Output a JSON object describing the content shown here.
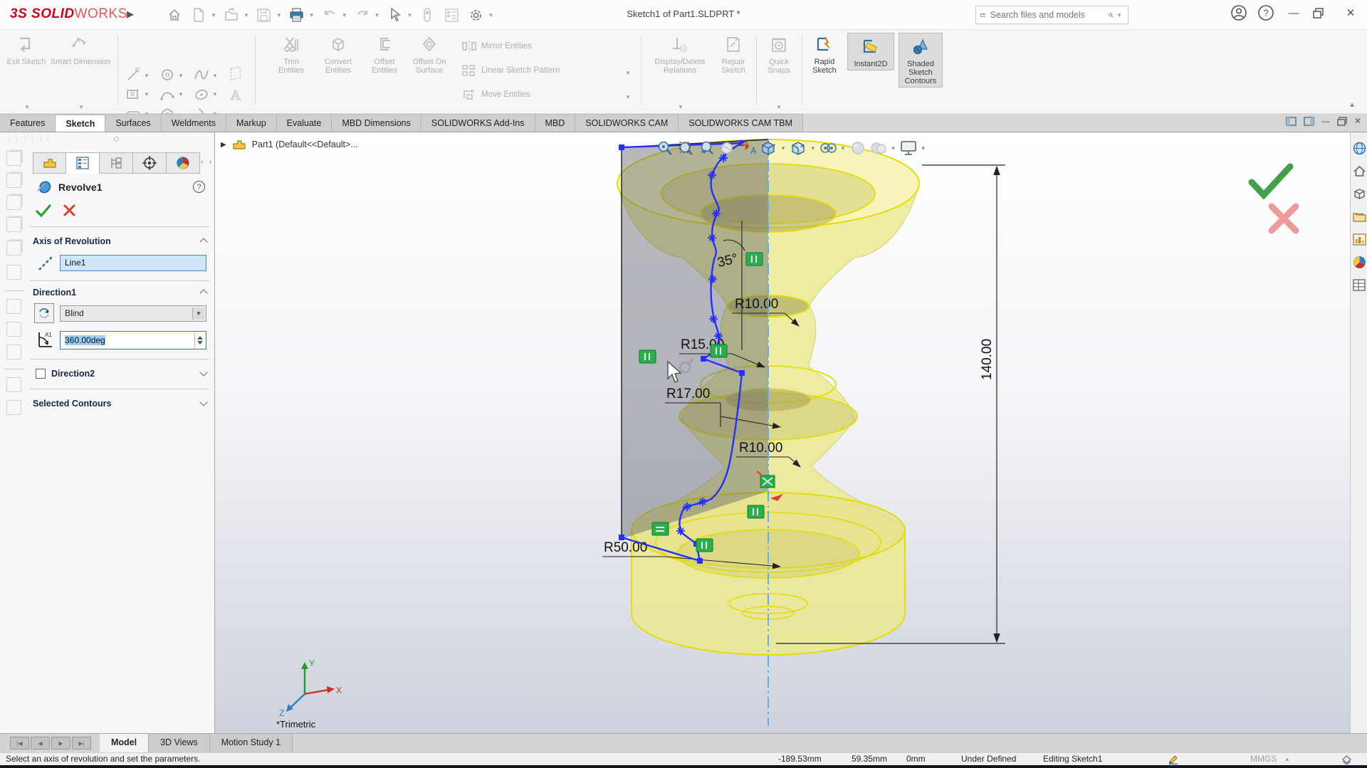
{
  "titlebar": {
    "logo_prefix": "3S",
    "logo_bold": "SOLID",
    "logo_light": "WORKS",
    "title": "Sketch1 of Part1.SLDPRT *",
    "search_placeholder": "Search files and models",
    "icons": [
      "home",
      "new-document",
      "open-document",
      "save",
      "print",
      "undo",
      "redo",
      "select-cursor",
      "touch-mode",
      "display-pane",
      "settings-gear",
      "user-account",
      "help",
      "minimize",
      "restore",
      "close"
    ]
  },
  "ribbon": {
    "exit_sketch": "Exit Sketch",
    "smart_dimension": "Smart Dimension",
    "trim_entities": "Trim Entities",
    "convert_entities": "Convert Entities",
    "offset_entities": "Offset Entities",
    "offset_on_surface": "Offset On Surface",
    "mirror_entities": "Mirror Entities",
    "linear_sketch_pattern": "Linear Sketch Pattern",
    "move_entities": "Move Entities",
    "display_delete_relations": "Display/Delete Relations",
    "repair_sketch": "Repair Sketch",
    "quick_snaps": "Quick Snaps",
    "rapid_sketch": "Rapid Sketch",
    "instant2d": "Instant2D",
    "shaded_sketch_contours": "Shaded Sketch Contours",
    "sketch_entity_icons": [
      "line",
      "circle",
      "spline",
      "plane",
      "rectangle",
      "arc",
      "ellipse",
      "text",
      "slot",
      "polygon",
      "three-point-arc",
      "point"
    ]
  },
  "tabs": {
    "items": [
      "Features",
      "Sketch",
      "Surfaces",
      "Weldments",
      "Markup",
      "Evaluate",
      "MBD Dimensions",
      "SOLIDWORKS Add-Ins",
      "MBD",
      "SOLIDWORKS CAM",
      "SOLIDWORKS CAM TBM"
    ],
    "active": "Sketch"
  },
  "property_manager": {
    "feature_name": "Revolve1",
    "help_label": "?",
    "tab_icons": [
      "feature-manager",
      "property-manager",
      "configuration-manager",
      "dimxpert-manager",
      "display-manager"
    ],
    "axis_section": {
      "title": "Axis of Revolution",
      "value": "Line1"
    },
    "direction1": {
      "title": "Direction1",
      "end_condition": "Blind",
      "angle_value": "360.00deg"
    },
    "direction2": {
      "title": "Direction2"
    },
    "selected_contours": {
      "title": "Selected Contours"
    }
  },
  "viewport": {
    "breadcrumb": "Part1  (Default<<Default>...",
    "view_orientation": "*Trimetric",
    "headsup_icons": [
      "zoom-to-fit",
      "zoom-to-area",
      "previous-view",
      "section-view",
      "dynamic-annotation-views",
      "view-orientation",
      "display-style",
      "hide-show-items",
      "edit-appearance",
      "apply-scene",
      "view-settings"
    ],
    "dimensions": {
      "angle": "35°",
      "radius_top": "R10.00",
      "radius_mid1": "R15.00",
      "radius_mid2": "R17.00",
      "radius_mid3": "R10.00",
      "radius_base": "R50.00",
      "height": "140.00"
    },
    "triad": {
      "x_label": "X",
      "y_label": "Y",
      "z_label": "Z"
    }
  },
  "taskpane_icons": [
    "3dexperience-globe",
    "solidworks-resources-home",
    "design-library",
    "file-explorer",
    "view-palette",
    "appearances-scenes",
    "custom-properties"
  ],
  "bottom_bar": {
    "tabs": [
      "Model",
      "3D Views",
      "Motion Study 1"
    ],
    "status_message": "Select an axis of revolution and set the parameters.",
    "coord_x": "-189.53mm",
    "coord_y": "59.35mm",
    "coord_z": "0mm",
    "sketch_state": "Under Defined",
    "edit_mode": "Editing Sketch1",
    "units": "MMGS"
  },
  "colors": {
    "sketch_blue": "#2430ff",
    "relation_green": "#27b04b",
    "preview_yellow": "#ece98f",
    "centerline_blue": "#58b2f2",
    "confirm_green": "#43a047",
    "cancel_red": "#ef9a9a",
    "logo_red": "#d6001c"
  }
}
